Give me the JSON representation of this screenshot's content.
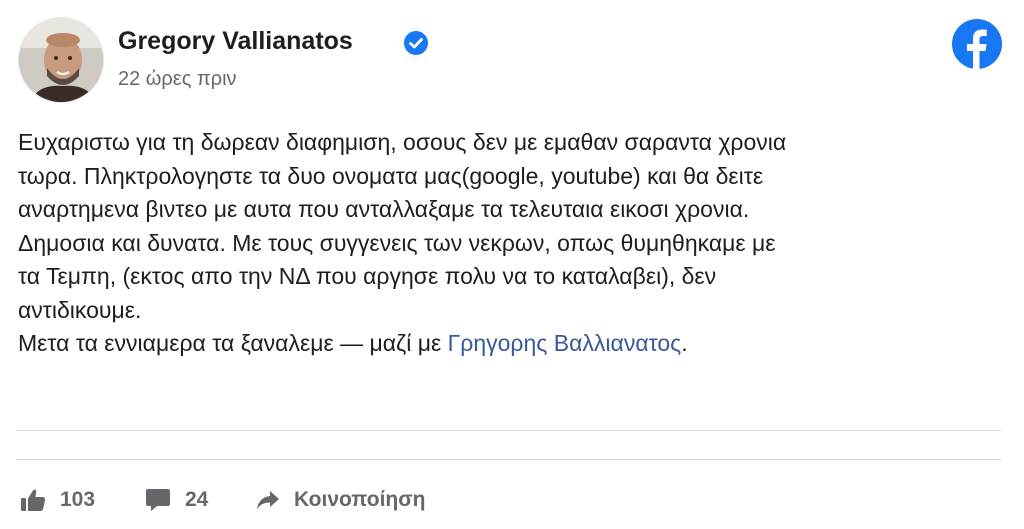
{
  "post": {
    "author_name": "Gregory Vallianatos",
    "timestamp": "22 ώρες πριν",
    "text_lines": [
      "Ευχαριστω για τη δωρεαν διαφημιση, οσους δεν με εμαθαν σαραντα χρονια",
      "τωρα. Πληκτρολογηστε τα δυο ονοματα μας(google, youtube) και θα δειτε",
      "αναρτημενα βιντεο με αυτα που ανταλλαξαμε τα τελευταια εικοσι χρονια.",
      "Δημοσια και δυνατα. Με τους συγγενεις των νεκρων, οπως θυμηθηκαμε με",
      "τα Τεμπη, (εκτος απο την ΝΔ που αργησε πολυ να το καταλαβει), δεν",
      "αντιδικουμε."
    ],
    "last_line_prefix": "Μετα τα εννιαμερα τα ξαναλεμε — μαζί με ",
    "mention": "Γρηγορης Βαλλιανατος",
    "last_line_suffix": "."
  },
  "actions": {
    "likes_count": "103",
    "comments_count": "24",
    "share_label": "Κοινοποίηση"
  },
  "colors": {
    "facebook_blue": "#1877f2",
    "mention": "#385898",
    "secondary_text": "#65676b"
  },
  "icons": [
    "avatar-photo",
    "verified-badge-icon",
    "facebook-logo-icon",
    "thumbs-up-icon",
    "comment-icon",
    "share-arrow-icon"
  ]
}
